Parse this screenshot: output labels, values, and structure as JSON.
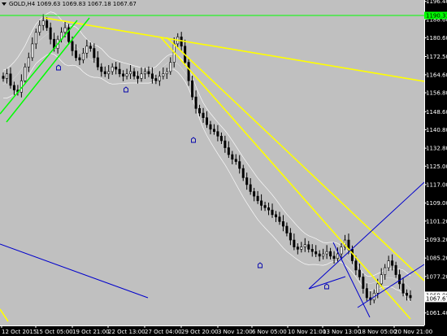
{
  "header": {
    "symbol": "GOLD,H4",
    "ohlc": "1069.63 1069.83 1067.18 1067.67"
  },
  "colors": {
    "plot_bg": "#c0c0c0",
    "frame_bg": "#000000",
    "candle": "#000000",
    "bands": "#ffffff",
    "trend_yellow": "#ffff00",
    "channel_green": "#00ff00",
    "channel_blue": "#0000cc",
    "price_tag": "#00ff00",
    "current_price_tag": "#ffffff"
  },
  "chart_data": {
    "type": "candlestick",
    "y_axis": {
      "min": 1056,
      "max": 1197,
      "ticks": [
        "1196.40",
        "1188.60",
        "1180.60",
        "1172.50",
        "1164.60",
        "1156.80",
        "1148.60",
        "1140.80",
        "1132.80",
        "1125.00",
        "1117.00",
        "1109.00",
        "1101.20",
        "1093.20",
        "1085.20",
        "1077.20",
        "1061.40"
      ],
      "price_tags": [
        {
          "label": "1190.31",
          "value": 1190.31,
          "color": "green"
        },
        {
          "label": "1069.08",
          "value": 1069.08,
          "color": "white"
        },
        {
          "label": "1067.67",
          "value": 1067.67,
          "color": "white"
        }
      ]
    },
    "x_axis": {
      "ticks": [
        "12 Oct 2015",
        "15 Oct 05:00",
        "19 Oct 21:00",
        "22 Oct 13:00",
        "27 Oct 04:00",
        "29 Oct 20:00",
        "3 Nov 12:00",
        "6 Nov 05:00",
        "10 Nov 21:00",
        "13 Nov 13:00",
        "18 Nov 05:00",
        "20 Nov 21:00"
      ]
    },
    "price_path": [
      1163,
      1165,
      1160,
      1158,
      1157,
      1162,
      1168,
      1172,
      1178,
      1183,
      1186,
      1188,
      1185,
      1180,
      1176,
      1180,
      1183,
      1185,
      1179,
      1175,
      1172,
      1171,
      1174,
      1177,
      1176,
      1172,
      1168,
      1166,
      1165,
      1166,
      1168,
      1167,
      1165,
      1164,
      1165,
      1166,
      1164,
      1163,
      1165,
      1166,
      1165,
      1163,
      1162,
      1164,
      1165,
      1166,
      1170,
      1178,
      1181,
      1177,
      1170,
      1162,
      1155,
      1150,
      1148,
      1146,
      1143,
      1141,
      1140,
      1138,
      1136,
      1133,
      1130,
      1128,
      1127,
      1124,
      1120,
      1117,
      1114,
      1112,
      1110,
      1108,
      1107,
      1106,
      1104,
      1103,
      1101,
      1099,
      1096,
      1093,
      1090,
      1089,
      1090,
      1091,
      1089,
      1088,
      1087,
      1086,
      1087,
      1088,
      1086,
      1085,
      1087,
      1090,
      1093,
      1089,
      1084,
      1080,
      1077,
      1072,
      1068,
      1067,
      1070,
      1074,
      1078,
      1081,
      1084,
      1082,
      1078,
      1074,
      1070,
      1069,
      1068
    ]
  }
}
